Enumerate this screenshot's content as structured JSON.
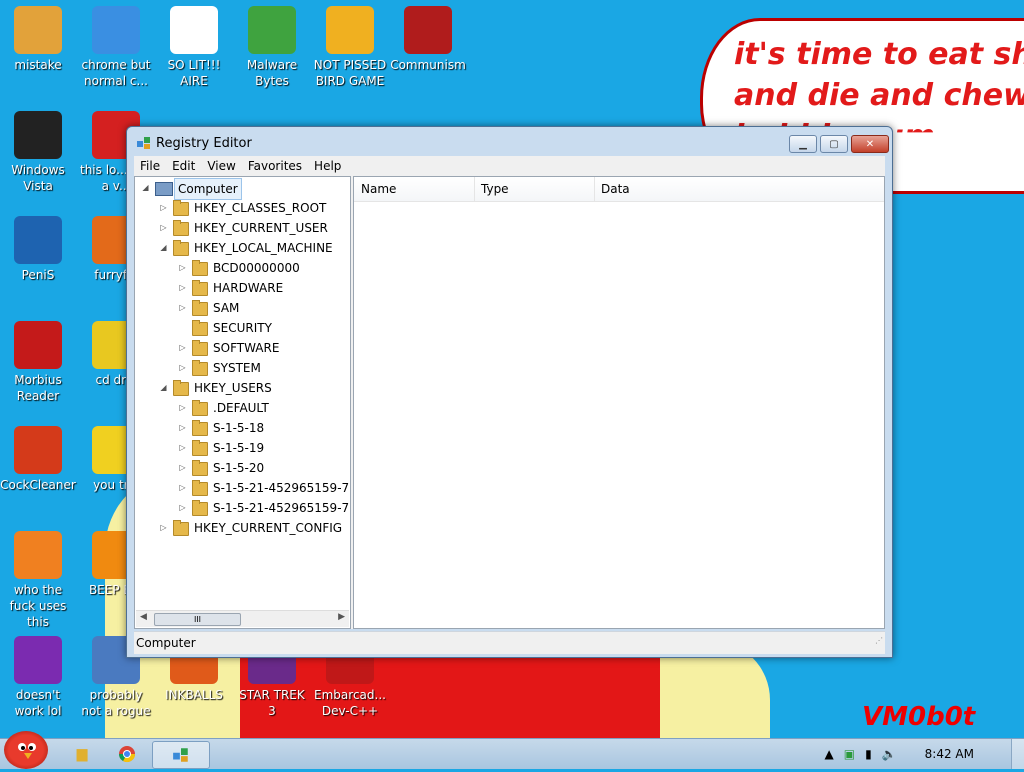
{
  "wallpaper": {
    "bubble_lines": [
      "it's time to eat shit",
      "and die and chew",
      "bubble gum"
    ],
    "signature": "VM0b0t"
  },
  "desktop_icons": [
    {
      "label": "mistake",
      "icon": "mistake-icon",
      "color": "#e2a23a"
    },
    {
      "label": "chrome but normal c...",
      "icon": "chrome-icon",
      "color": "#3a8fe2"
    },
    {
      "label": "SO LIT!!! AIRE",
      "icon": "solitaire-icon",
      "color": "#ffffff"
    },
    {
      "label": "Malware Bytes",
      "icon": "malwarebytes-icon",
      "color": "#3fa33f"
    },
    {
      "label": "NOT PISSED BIRD GAME",
      "icon": "angry-birds-icon",
      "color": "#f0b020"
    },
    {
      "label": "Communism",
      "icon": "communism-icon",
      "color": "#b01c1c"
    },
    {
      "label": "Windows Vista",
      "icon": "trash-icon",
      "color": "#222222"
    },
    {
      "label": "this lo... like a v...",
      "icon": "opera-icon",
      "color": "#d42020"
    },
    {
      "label": "PeniS",
      "icon": "photoshop-icon",
      "color": "#1e63b0"
    },
    {
      "label": "furryf...",
      "icon": "firefox-icon",
      "color": "#e36a1a"
    },
    {
      "label": "Morbius Reader",
      "icon": "acrobat-icon",
      "color": "#c41a1a"
    },
    {
      "label": "cd dr...",
      "icon": "cd-icon",
      "color": "#e8c820"
    },
    {
      "label": "CockCleaner",
      "icon": "ccleaner-icon",
      "color": "#d43a1a"
    },
    {
      "label": "you tr...",
      "icon": "star-icon",
      "color": "#f0d020"
    },
    {
      "label": "who the fuck uses this",
      "icon": "avast-icon",
      "color": "#f08020"
    },
    {
      "label": "BEEP B...",
      "icon": "vlc-icon",
      "color": "#f08a10"
    },
    {
      "label": "doesn't work lol",
      "icon": "yahoo-icon",
      "color": "#7b2bb0"
    },
    {
      "label": "probably not a rogue",
      "icon": "computer-icon",
      "color": "#4a7ac0"
    },
    {
      "label": "INKBALLS",
      "icon": "inkball-icon",
      "color": "#e05a1a"
    },
    {
      "label": "STAR TREK 3",
      "icon": "startrek-icon",
      "color": "#6a2a8a"
    },
    {
      "label": "Embarcad... Dev-C++",
      "icon": "devcpp-icon",
      "color": "#c01818"
    }
  ],
  "window": {
    "title": "Registry Editor",
    "menu": [
      "File",
      "Edit",
      "View",
      "Favorites",
      "Help"
    ],
    "tree": {
      "root": "Computer",
      "hives": [
        {
          "label": "HKEY_CLASSES_ROOT",
          "expanded": false
        },
        {
          "label": "HKEY_CURRENT_USER",
          "expanded": false
        },
        {
          "label": "HKEY_LOCAL_MACHINE",
          "expanded": true,
          "children": [
            "BCD00000000",
            "HARDWARE",
            "SAM",
            "SECURITY",
            "SOFTWARE",
            "SYSTEM"
          ]
        },
        {
          "label": "HKEY_USERS",
          "expanded": true,
          "children": [
            ".DEFAULT",
            "S-1-5-18",
            "S-1-5-19",
            "S-1-5-20",
            "S-1-5-21-452965159-7",
            "S-1-5-21-452965159-7"
          ]
        },
        {
          "label": "HKEY_CURRENT_CONFIG",
          "expanded": false
        }
      ],
      "scroll_thumb": "III"
    },
    "columns": [
      "Name",
      "Type",
      "Data"
    ],
    "status": "Computer"
  },
  "taskbar": {
    "clock": "8:42 AM",
    "items": [
      "explorer-icon",
      "chrome-icon",
      "regedit-icon"
    ]
  }
}
